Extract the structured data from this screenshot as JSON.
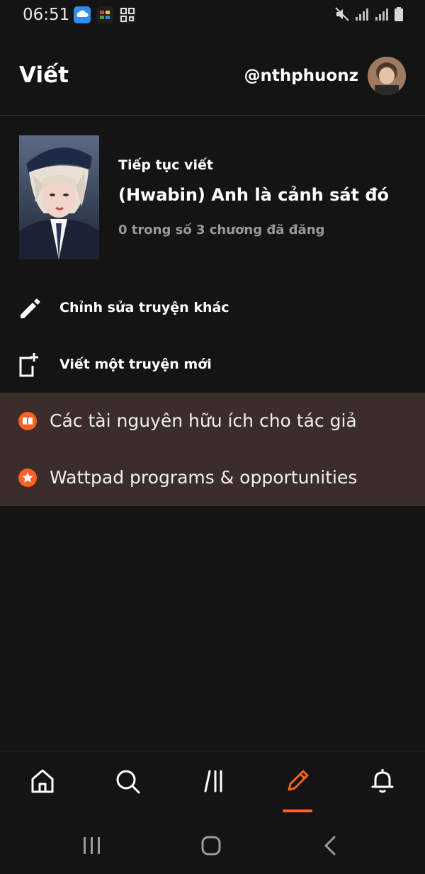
{
  "status_bar": {
    "time": "06:51",
    "app_icons": [
      "cloud-app-icon",
      "color-grid-app-icon",
      "qr-app-icon"
    ],
    "indicators": [
      "mute-icon",
      "signal-icon",
      "signal-icon",
      "battery-icon"
    ]
  },
  "header": {
    "title": "Viết",
    "username": "@nthphuonz"
  },
  "continue_writing": {
    "label": "Tiếp tục viết",
    "story_title": "(Hwabin) Anh là cảnh sát đó",
    "chapter_info": "0 trong số 3 chương đã đăng"
  },
  "actions": [
    {
      "label": "Chỉnh sửa truyện khác",
      "icon": "pencil-icon"
    },
    {
      "label": "Viết một truyện mới",
      "icon": "new-document-icon"
    }
  ],
  "resources": [
    {
      "label": "Các tài nguyên hữu ích cho tác giả",
      "icon": "book-icon"
    },
    {
      "label": "Wattpad programs & opportunities",
      "icon": "star-icon"
    }
  ],
  "bottom_nav": {
    "items": [
      "home-icon",
      "search-icon",
      "library-icon",
      "write-icon",
      "notifications-icon"
    ],
    "active": "write-icon"
  },
  "colors": {
    "accent": "#ff6122",
    "background": "#141414",
    "resources_bg": "#3b2d2b",
    "muted_text": "#9a9a9a"
  }
}
